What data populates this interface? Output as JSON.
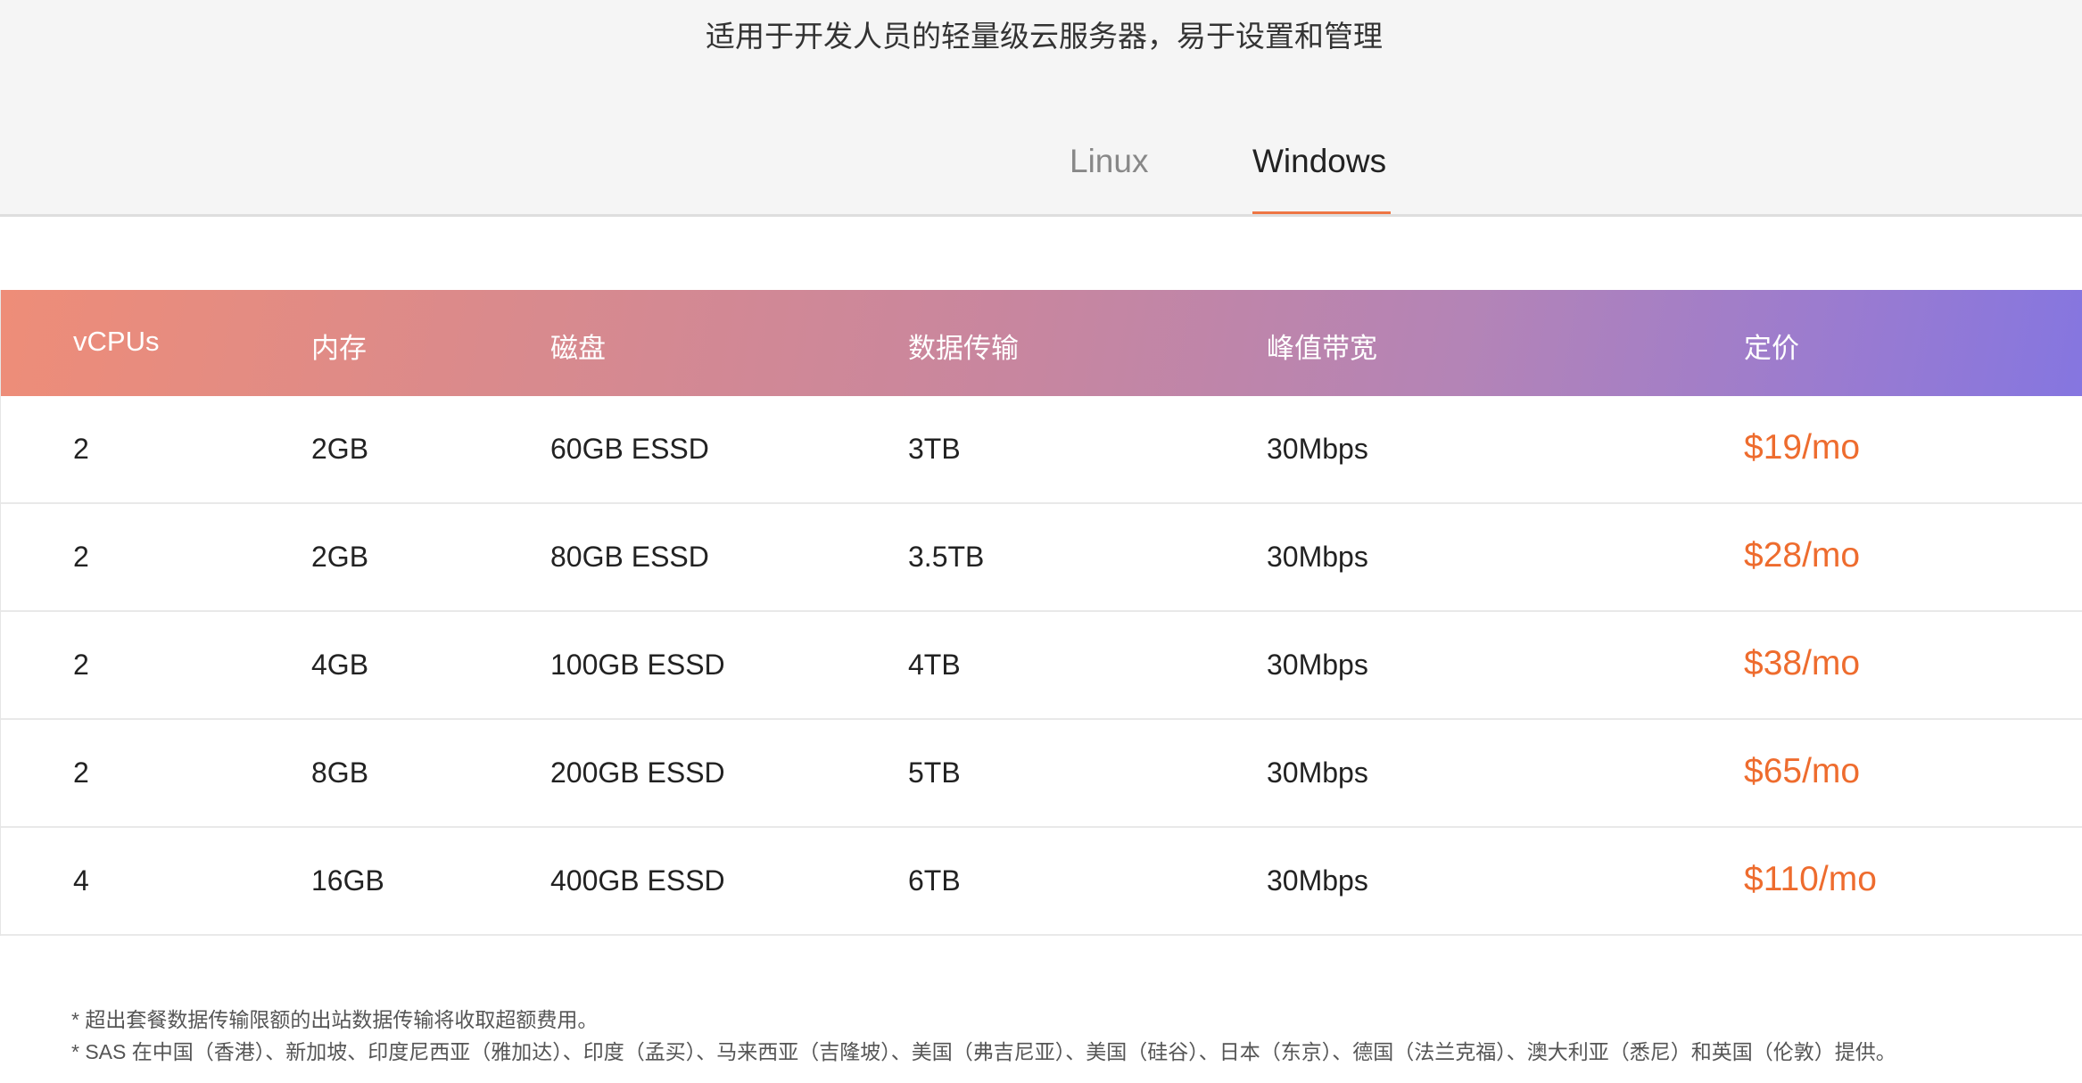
{
  "header": {
    "subtitle": "适用于开发人员的轻量级云服务器，易于设置和管理"
  },
  "tabs": [
    {
      "label": "Linux",
      "active": false
    },
    {
      "label": "Windows",
      "active": true
    }
  ],
  "colors": {
    "accent": "#ee7644",
    "price": "#ee6c2e",
    "header_gradient_start": "#ee8d78",
    "header_gradient_end": "#8576e0"
  },
  "table": {
    "columns": [
      "vCPUs",
      "内存",
      "磁盘",
      "数据传输",
      "峰值带宽",
      "定价"
    ],
    "rows": [
      {
        "vcpus": "2",
        "memory": "2GB",
        "disk": "60GB ESSD",
        "transfer": "3TB",
        "bandwidth": "30Mbps",
        "price": "$19/mo"
      },
      {
        "vcpus": "2",
        "memory": "2GB",
        "disk": "80GB ESSD",
        "transfer": "3.5TB",
        "bandwidth": "30Mbps",
        "price": "$28/mo"
      },
      {
        "vcpus": "2",
        "memory": "4GB",
        "disk": "100GB ESSD",
        "transfer": "4TB",
        "bandwidth": "30Mbps",
        "price": "$38/mo"
      },
      {
        "vcpus": "2",
        "memory": "8GB",
        "disk": "200GB ESSD",
        "transfer": "5TB",
        "bandwidth": "30Mbps",
        "price": "$65/mo"
      },
      {
        "vcpus": "4",
        "memory": "16GB",
        "disk": "400GB ESSD",
        "transfer": "6TB",
        "bandwidth": "30Mbps",
        "price": "$110/mo"
      }
    ]
  },
  "notes": [
    "* 超出套餐数据传输限额的出站数据传输将收取超额费用。",
    "* SAS 在中国（香港）、新加坡、印度尼西亚（雅加达）、印度（孟买）、马来西亚（吉隆坡）、美国（弗吉尼亚）、美国（硅谷）、日本（东京）、德国（法兰克福）、澳大利亚（悉尼）和英国（伦敦）提供。"
  ]
}
